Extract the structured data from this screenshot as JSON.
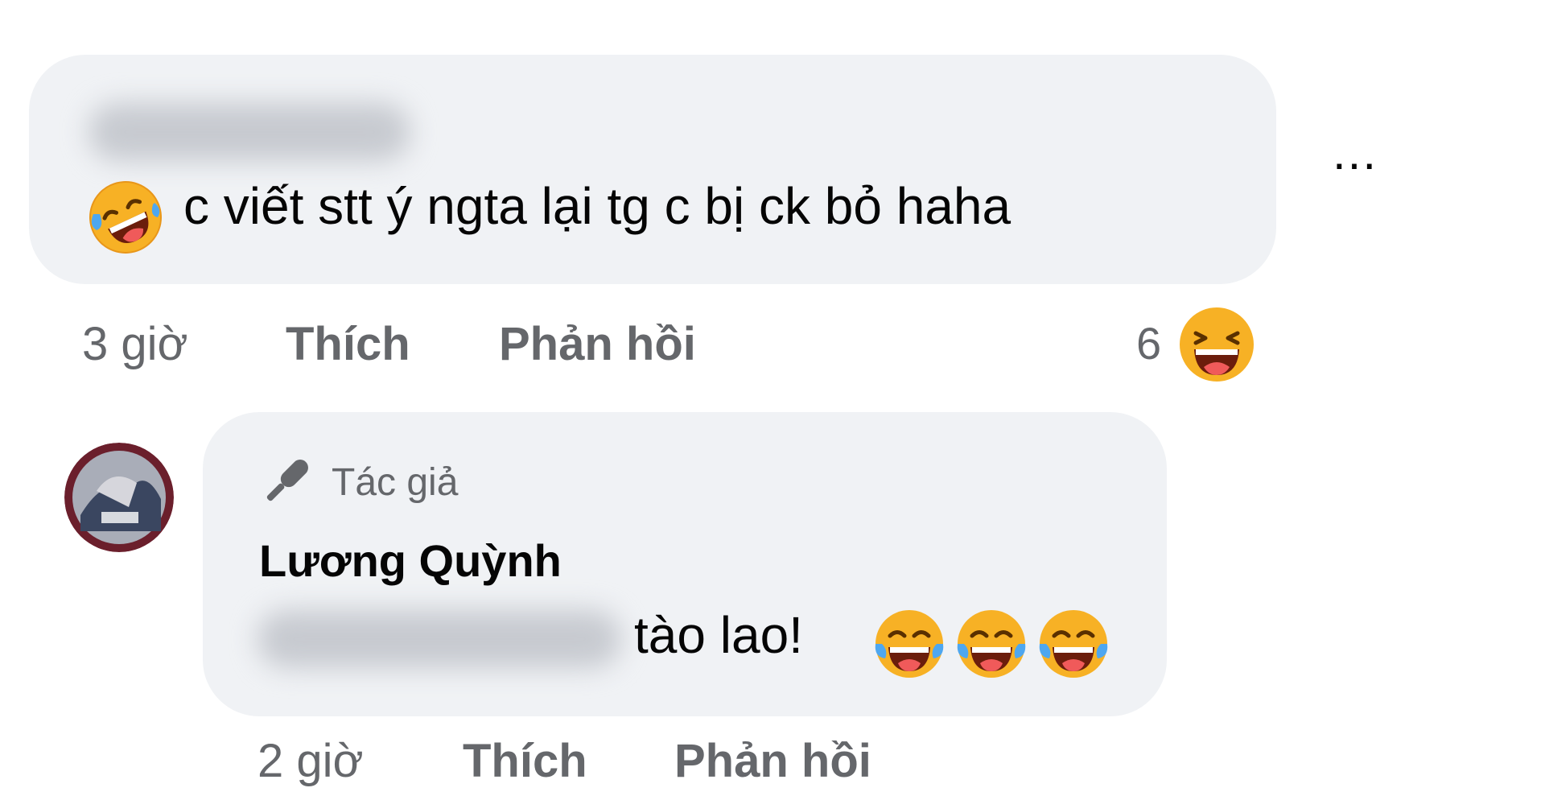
{
  "comment1": {
    "text": "c viết stt ý ngta lại tg c bị ck bỏ haha",
    "time": "3 giờ",
    "like_label": "Thích",
    "reply_label": "Phản hồi",
    "reaction_count": "6",
    "reaction_icon": "haha-reaction-icon",
    "leading_emoji": "rolling-on-floor-laughing-emoji"
  },
  "more_options": "...",
  "reply": {
    "badge_label": "Tác giả",
    "badge_icon": "pen-icon",
    "author_name": "Lương Quỳnh",
    "text": "tào lao!",
    "emojis": [
      "tears-of-joy-emoji",
      "tears-of-joy-emoji",
      "tears-of-joy-emoji"
    ],
    "time": "2 giờ",
    "like_label": "Thích",
    "reply_label": "Phản hồi"
  },
  "colors": {
    "bubble_bg": "#f0f2f5",
    "secondary_text": "#65676b",
    "primary_text": "#050505"
  }
}
